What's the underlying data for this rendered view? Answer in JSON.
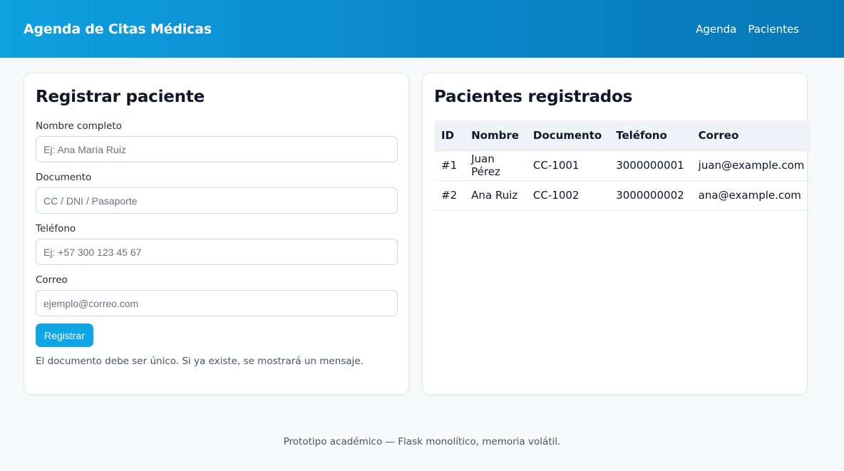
{
  "header": {
    "title": "Agenda de Citas Médicas",
    "nav": [
      {
        "label": "Agenda"
      },
      {
        "label": "Pacientes"
      }
    ]
  },
  "register_form": {
    "title": "Registrar paciente",
    "fields": [
      {
        "label": "Nombre completo",
        "placeholder": "Ej: Ana María Ruiz",
        "value": ""
      },
      {
        "label": "Documento",
        "placeholder": "CC / DNI / Pasaporte",
        "value": ""
      },
      {
        "label": "Teléfono",
        "placeholder": "Ej: +57 300 123 45 67",
        "value": ""
      },
      {
        "label": "Correo",
        "placeholder": "ejemplo@correo.com",
        "value": ""
      }
    ],
    "submit_label": "Registrar",
    "hint": "El documento debe ser único. Si ya existe, se mostrará un mensaje."
  },
  "patients": {
    "title": "Pacientes registrados",
    "columns": [
      "ID",
      "Nombre",
      "Documento",
      "Teléfono",
      "Correo"
    ],
    "rows": [
      [
        "#1",
        "Juan Pérez",
        "CC-1001",
        "3000000001",
        "juan@example.com"
      ],
      [
        "#2",
        "Ana Ruiz",
        "CC-1002",
        "3000000002",
        "ana@example.com"
      ]
    ]
  },
  "footer": {
    "text": "Prototipo académico — Flask monolítico, memoria volátil."
  },
  "colors": {
    "header_start": "#0ea0e1",
    "header_end": "#0877b6",
    "button": "#10a5e6",
    "table_header_bg": "#eff3f8"
  }
}
